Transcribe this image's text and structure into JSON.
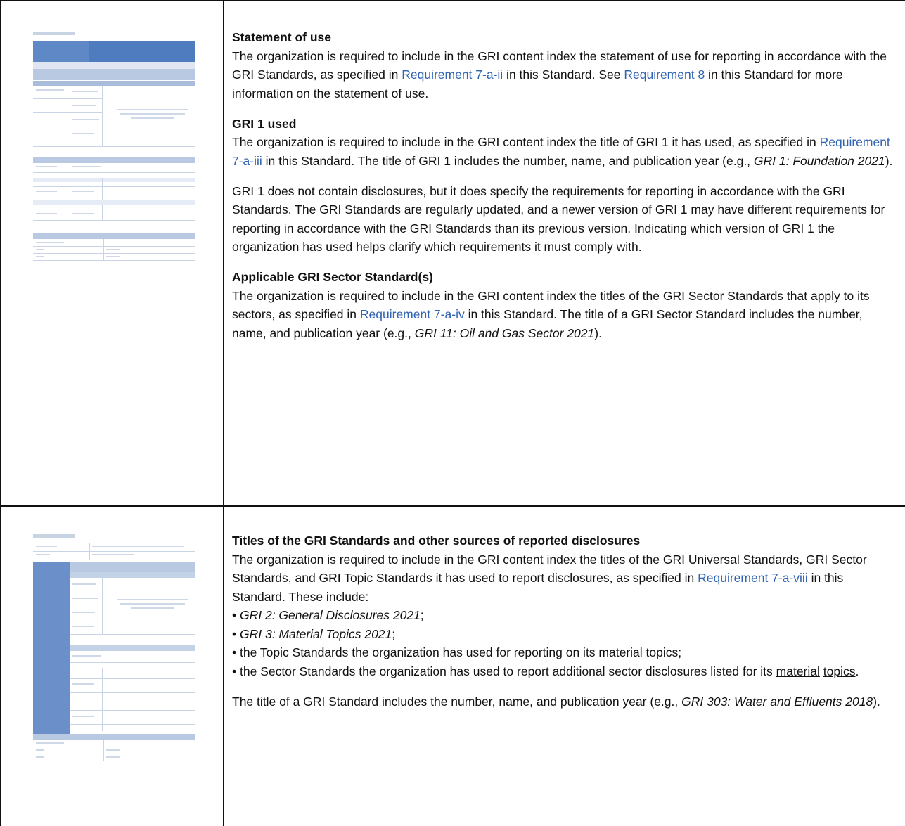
{
  "rows": [
    {
      "sections": [
        {
          "heading": "Statement of use",
          "paragraphs": [
            {
              "t1": "The organization is required to include in the GRI content index the statement of use for reporting in accordance with the GRI Standards, as specified in ",
              "link1": "Requirement 7-a-ii",
              "t2": " in this Standard. See ",
              "link2": "Requirement 8",
              "t3": " in this Standard for more information on the statement of use."
            }
          ]
        },
        {
          "heading": "GRI 1 used",
          "paragraphs": [
            {
              "t1": "The organization is required to include in the GRI content index the title of GRI 1 it has used, as specified in ",
              "link1": "Requirement 7-a-iii",
              "t2": " in this Standard. The title of GRI 1 includes the number, name, and publication year (e.g., ",
              "em1": "GRI 1: Foundation 2021",
              "t3": ")."
            },
            {
              "t1": "GRI 1 does not contain disclosures, but it does specify the requirements for reporting in accordance with the GRI Standards. The GRI Standards are regularly updated, and a newer version of GRI 1 may have different requirements for reporting in accordance with the GRI Standards than its previous version. Indicating which version of GRI 1 the organization has used helps clarify which requirements it must comply with."
            }
          ]
        },
        {
          "heading": "Applicable GRI Sector Standard(s)",
          "paragraphs": [
            {
              "t1": "The organization is required to include in the GRI content index the titles of the GRI Sector Standards that apply to its sectors, as specified in ",
              "link1": "Requirement 7-a-iv",
              "t2": " in this Standard. The title of a GRI Sector Standard includes the number, name, and publication year (e.g., ",
              "em1": "GRI 11: Oil and Gas Sector 2021",
              "t3": ")."
            }
          ]
        }
      ]
    },
    {
      "sections": [
        {
          "heading": "Titles of the GRI Standards and other sources of reported disclosures",
          "paragraphs": [
            {
              "t1": "The organization is required to include in the GRI content index the titles of the GRI Universal Standards, GRI Sector Standards, and GRI Topic Standards it has used to report disclosures, as specified in ",
              "link1": "Requirement 7-a-viii",
              "t2": " in this Standard. These include:"
            }
          ],
          "bullets": [
            {
              "mark": "• ",
              "em": "GRI 2: General Disclosures 2021",
              "after": ";"
            },
            {
              "mark": "• ",
              "em": "GRI 3: Material Topics 2021",
              "after": ";"
            },
            {
              "mark": "• ",
              "text": "the Topic Standards the organization has used for reporting on its material topics;"
            },
            {
              "mark": "• ",
              "text": "the Sector Standards the organization has used to report additional sector disclosures listed for its ",
              "u1": "material",
              "sp": " ",
              "u2": "topics",
              "after": "."
            }
          ],
          "closing": {
            "t1": "The title of a GRI Standard includes the number, name, and publication year (e.g., ",
            "em1": "GRI 303: Water and Effluents 2018",
            "t2": ")."
          }
        }
      ]
    }
  ]
}
